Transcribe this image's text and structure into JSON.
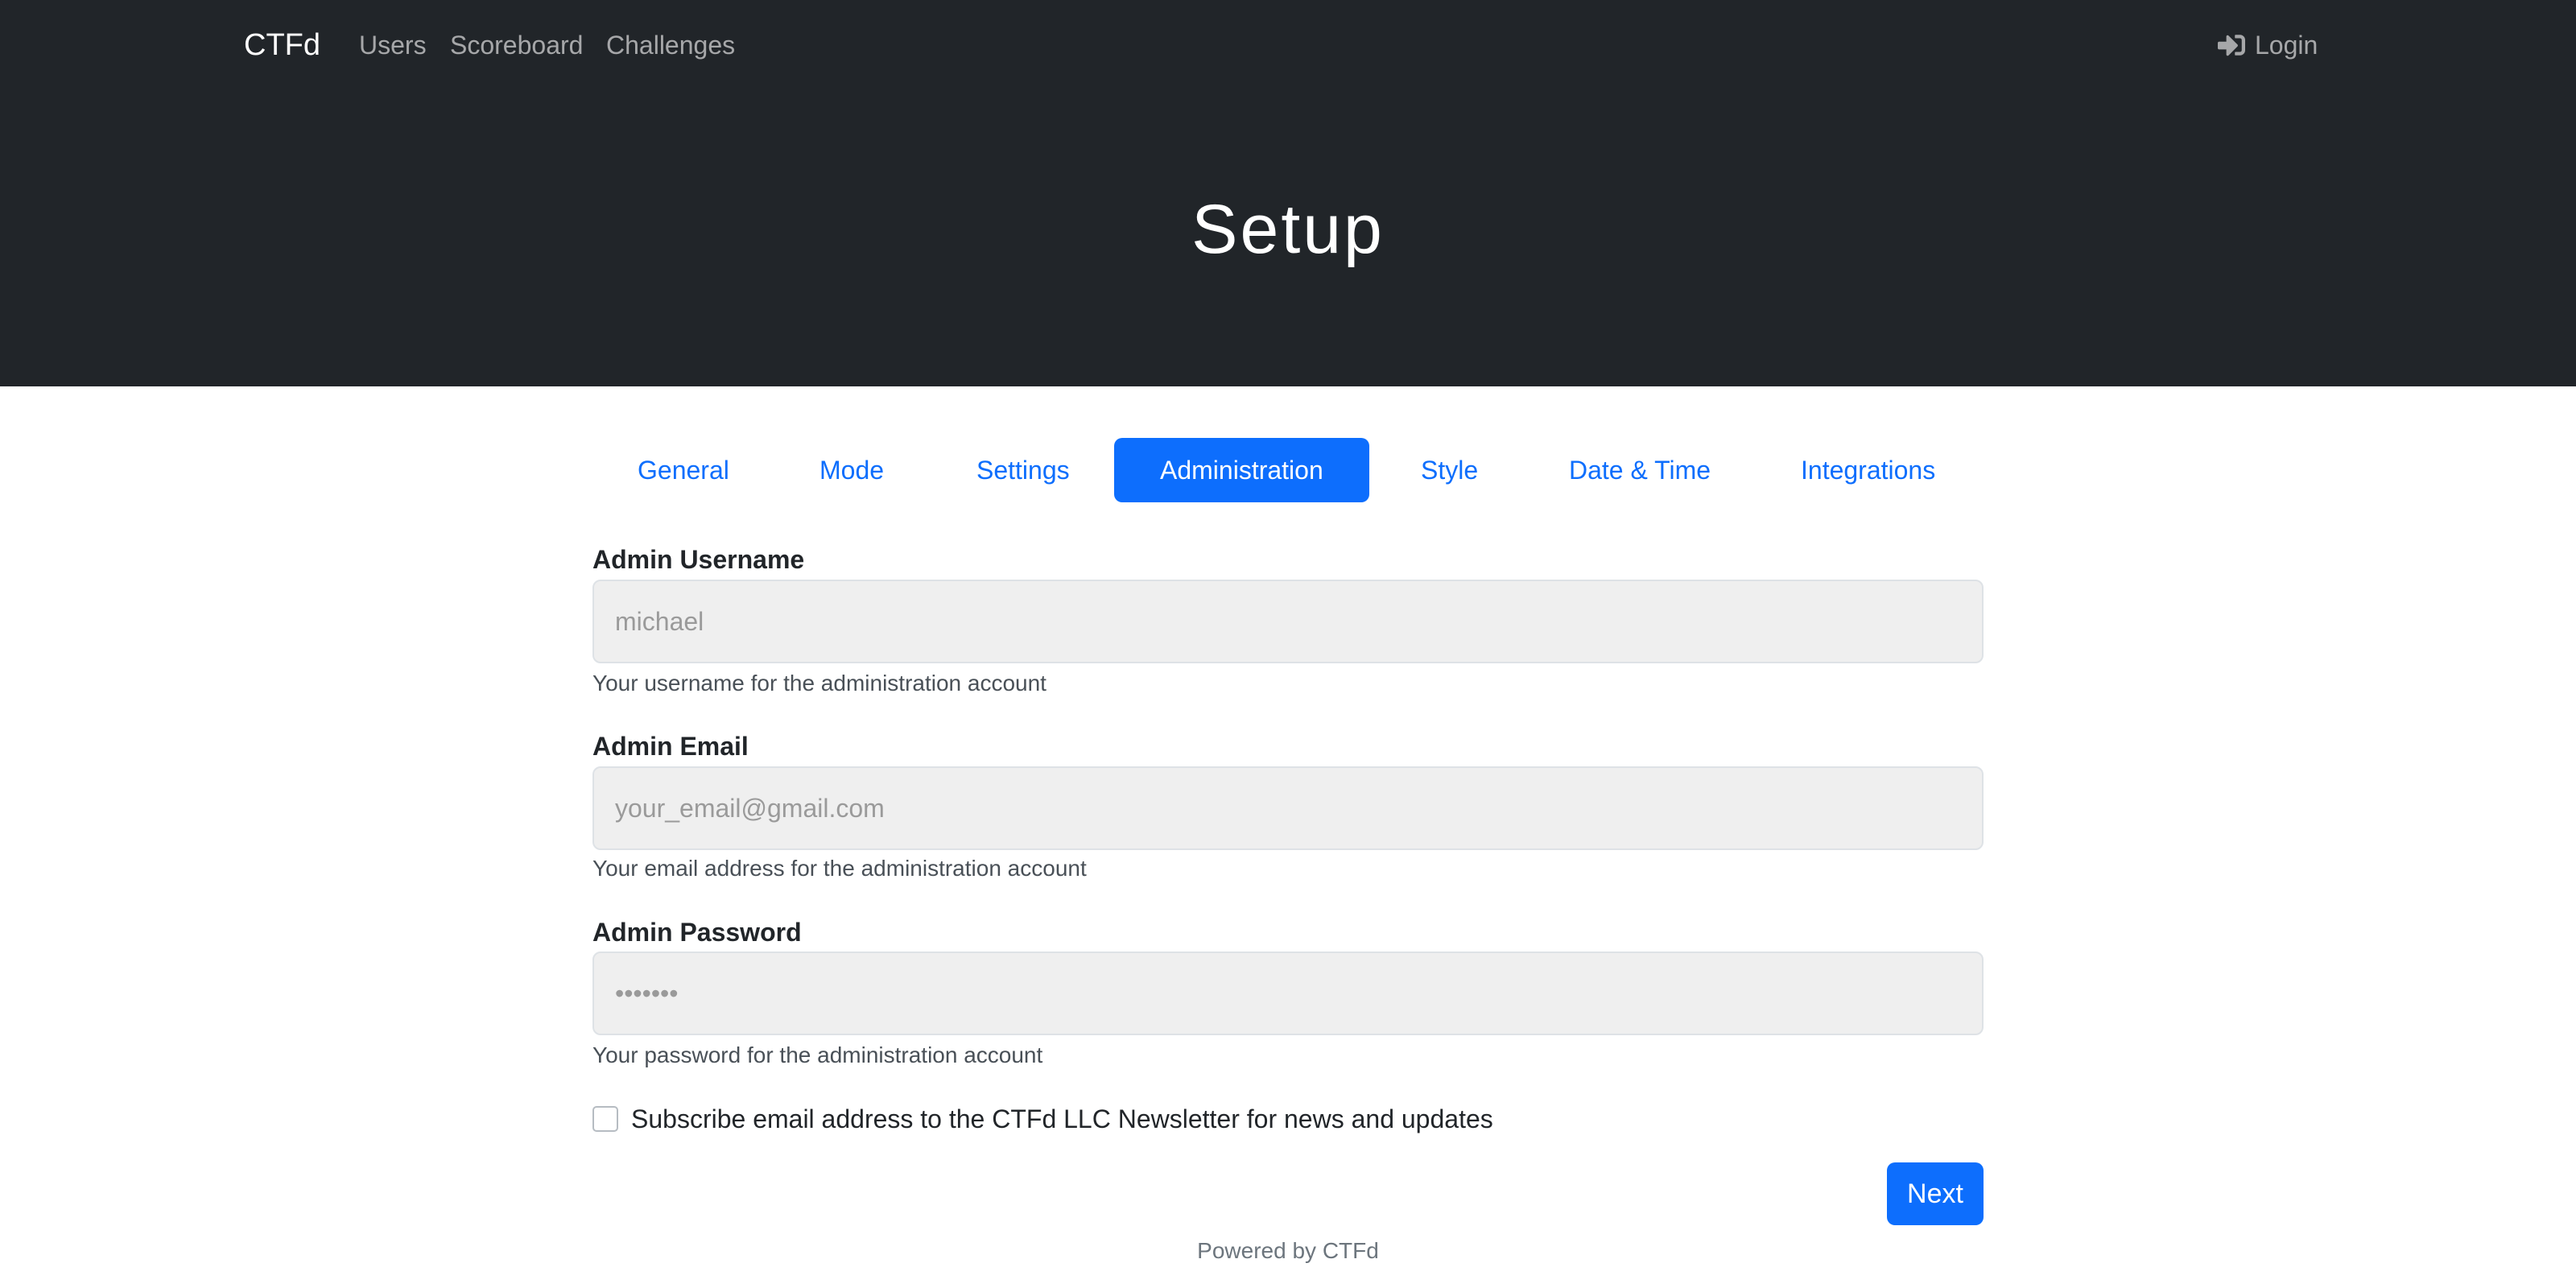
{
  "nav": {
    "brand": "CTFd",
    "links": [
      "Users",
      "Scoreboard",
      "Challenges"
    ],
    "login_label": "Login"
  },
  "hero": {
    "title": "Setup"
  },
  "tabs": [
    {
      "label": "General",
      "active": false
    },
    {
      "label": "Mode",
      "active": false
    },
    {
      "label": "Settings",
      "active": false
    },
    {
      "label": "Administration",
      "active": true
    },
    {
      "label": "Style",
      "active": false
    },
    {
      "label": "Date & Time",
      "active": false
    },
    {
      "label": "Integrations",
      "active": false
    }
  ],
  "form": {
    "username": {
      "label": "Admin Username",
      "placeholder": "michael",
      "help": "Your username for the administration account"
    },
    "email": {
      "label": "Admin Email",
      "placeholder": "your_email@gmail.com",
      "help": "Your email address for the administration account"
    },
    "password": {
      "label": "Admin Password",
      "placeholder": "•••••••",
      "help": "Your password for the administration account"
    },
    "newsletter_label": "Subscribe email address to the CTFd LLC Newsletter for news and updates",
    "newsletter_checked": false,
    "next_label": "Next"
  },
  "footer": {
    "text": "Powered by CTFd"
  },
  "colors": {
    "header_bg": "#212529",
    "accent": "#0d6efd",
    "input_bg": "#efefef"
  },
  "icons": {
    "login": "sign-in-icon"
  }
}
